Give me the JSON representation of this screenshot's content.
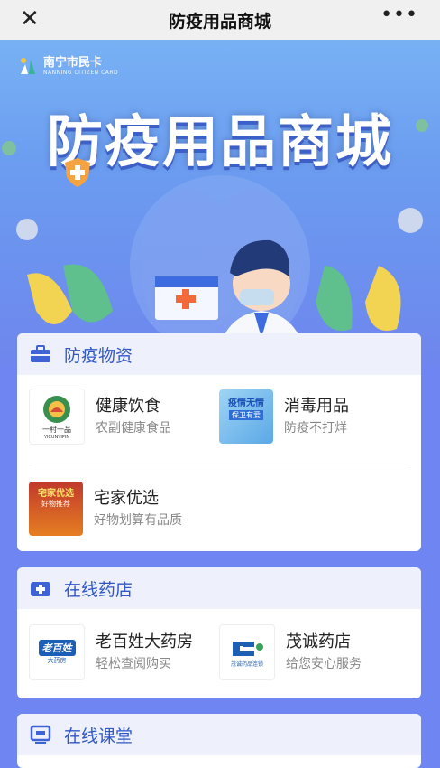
{
  "topbar": {
    "close_label": "✕",
    "title": "防疫用品商城",
    "more_label": "•••"
  },
  "banner": {
    "logo_name": "南宁市民卡",
    "logo_sub": "NANNING CITIZEN CARD",
    "headline": "防疫用品商城"
  },
  "sections": [
    {
      "title": "防疫物资",
      "icon": "briefcase-icon",
      "items": [
        {
          "name": "健康饮食",
          "desc": "农副健康食品",
          "thumb_text": "一村一品",
          "thumb_sub": "YICUNYIPIN"
        },
        {
          "name": "消毒用品",
          "desc": "防疫不打烊",
          "thumb_text": "疫情无情",
          "thumb_sub": "保卫有爱"
        },
        {
          "name": "宅家优选",
          "desc": "好物划算有品质",
          "thumb_text": "宅家优选",
          "thumb_sub": "好物推荐"
        }
      ]
    },
    {
      "title": "在线药店",
      "icon": "medical-kit-icon",
      "items": [
        {
          "name": "老百姓大药房",
          "desc": "轻松查阅购买",
          "thumb_text": "老百姓",
          "thumb_sub": "大药房"
        },
        {
          "name": "茂诚药店",
          "desc": "给您安心服务",
          "thumb_text": "茂诚药品连锁",
          "thumb_sub": ""
        }
      ]
    },
    {
      "title": "在线课堂",
      "icon": "classroom-icon",
      "items": []
    }
  ],
  "colors": {
    "accent": "#2f57c6",
    "background": "#6f86f2"
  }
}
